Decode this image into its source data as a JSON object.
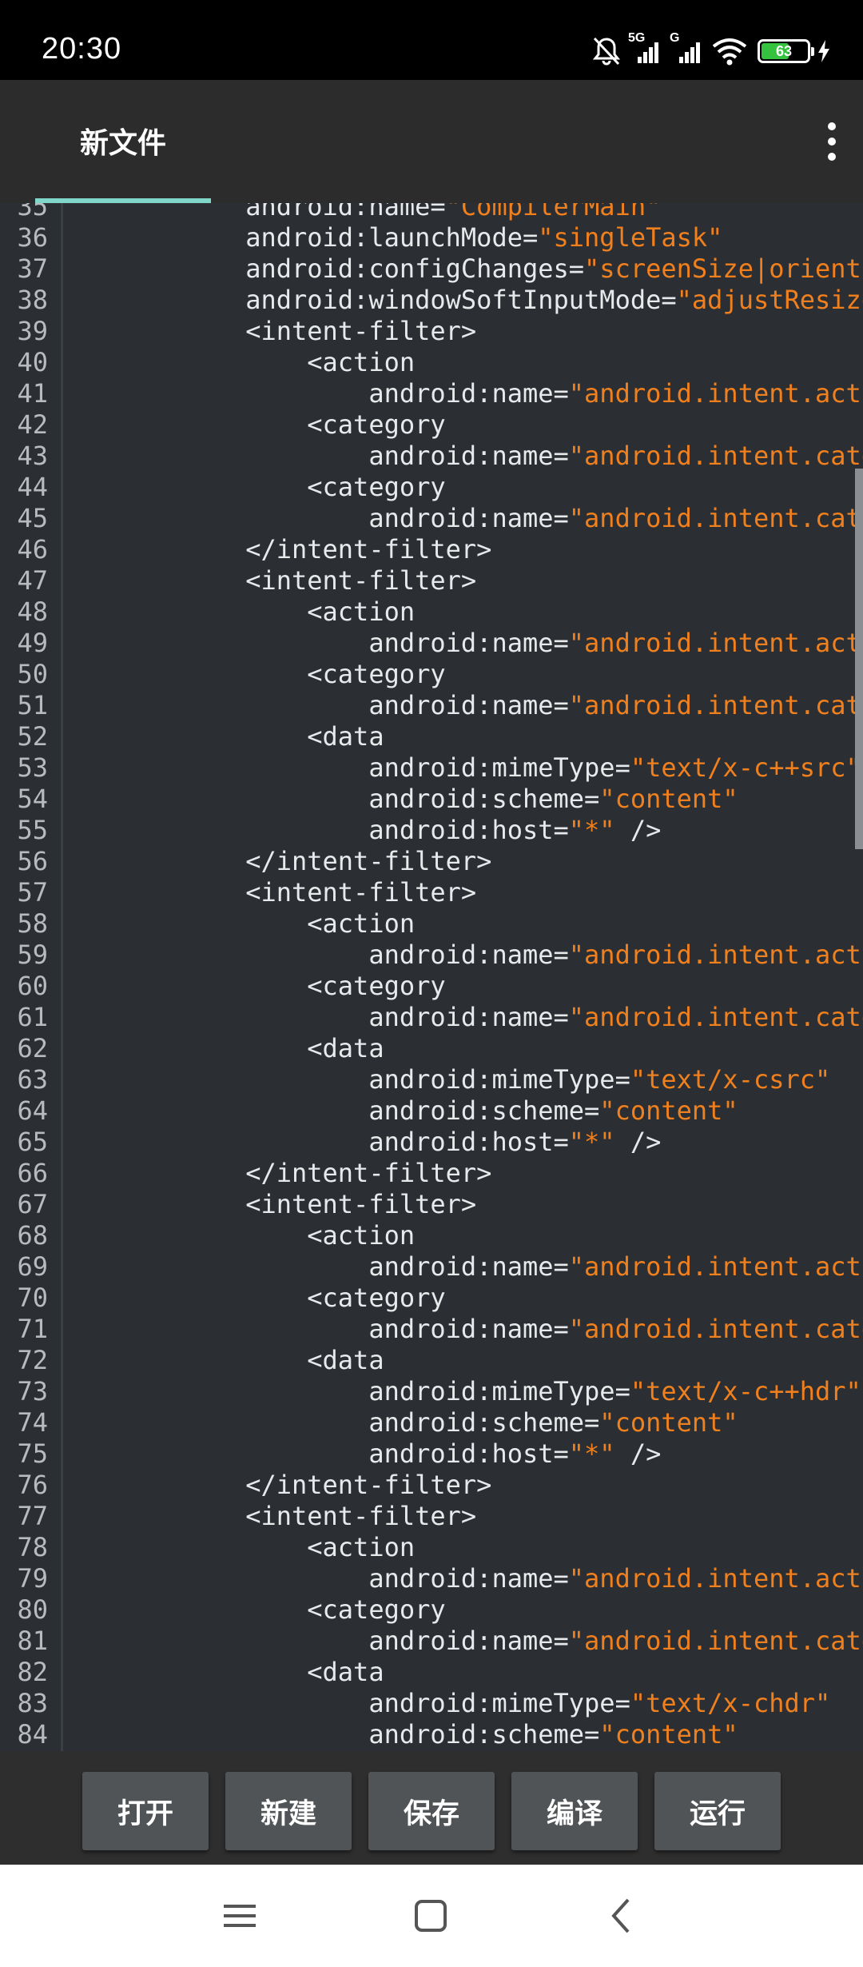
{
  "status_bar": {
    "time": "20:30",
    "network_1": "5G",
    "network_2": "G",
    "battery": "63",
    "icons": [
      "mute-icon",
      "signal-icon",
      "signal-icon",
      "wifi-icon",
      "battery-icon",
      "charging-icon"
    ]
  },
  "app_bar": {
    "tab_label": "新文件",
    "menu_icon": "overflow-menu-icon",
    "accent": "#7fd6c9"
  },
  "editor": {
    "colors": {
      "text": "#e7e9eb",
      "string": "#f0801e",
      "line_number": "#b7bbbf",
      "background": "#2b2f33"
    },
    "lines": [
      {
        "n": "35",
        "code": [
          [
            "            android:name=",
            "t"
          ],
          [
            "\"CompilerMain\"",
            "s"
          ]
        ]
      },
      {
        "n": "36",
        "code": [
          [
            "            android:launchMode=",
            "t"
          ],
          [
            "\"singleTask\"",
            "s"
          ]
        ]
      },
      {
        "n": "37",
        "code": [
          [
            "            android:configChanges=",
            "t"
          ],
          [
            "\"screenSize|orientation\"",
            "s"
          ]
        ]
      },
      {
        "n": "38",
        "code": [
          [
            "            android:windowSoftInputMode=",
            "t"
          ],
          [
            "\"adjustResize\"",
            "s"
          ]
        ]
      },
      {
        "n": "39",
        "code": [
          [
            "            <intent-filter>",
            "t"
          ]
        ]
      },
      {
        "n": "40",
        "code": [
          [
            "                <action",
            "t"
          ]
        ]
      },
      {
        "n": "41",
        "code": [
          [
            "                    android:name=",
            "t"
          ],
          [
            "\"android.intent.action.VIEW\"",
            "s"
          ]
        ]
      },
      {
        "n": "42",
        "code": [
          [
            "                <category",
            "t"
          ]
        ]
      },
      {
        "n": "43",
        "code": [
          [
            "                    android:name=",
            "t"
          ],
          [
            "\"android.intent.category.DEFAULT\"",
            "s"
          ]
        ]
      },
      {
        "n": "44",
        "code": [
          [
            "                <category",
            "t"
          ]
        ]
      },
      {
        "n": "45",
        "code": [
          [
            "                    android:name=",
            "t"
          ],
          [
            "\"android.intent.category.BROWSABLE\"",
            "s"
          ]
        ]
      },
      {
        "n": "46",
        "code": [
          [
            "            </intent-filter>",
            "t"
          ]
        ]
      },
      {
        "n": "47",
        "code": [
          [
            "            <intent-filter>",
            "t"
          ]
        ]
      },
      {
        "n": "48",
        "code": [
          [
            "                <action",
            "t"
          ]
        ]
      },
      {
        "n": "49",
        "code": [
          [
            "                    android:name=",
            "t"
          ],
          [
            "\"android.intent.action.VIEW\"",
            "s"
          ]
        ]
      },
      {
        "n": "50",
        "code": [
          [
            "                <category",
            "t"
          ]
        ]
      },
      {
        "n": "51",
        "code": [
          [
            "                    android:name=",
            "t"
          ],
          [
            "\"android.intent.category.DEFAULT\"",
            "s"
          ]
        ]
      },
      {
        "n": "52",
        "code": [
          [
            "                <data",
            "t"
          ]
        ]
      },
      {
        "n": "53",
        "code": [
          [
            "                    android:mimeType=",
            "t"
          ],
          [
            "\"text/x-c++src\"",
            "s"
          ]
        ]
      },
      {
        "n": "54",
        "code": [
          [
            "                    android:scheme=",
            "t"
          ],
          [
            "\"content\"",
            "s"
          ]
        ]
      },
      {
        "n": "55",
        "code": [
          [
            "                    android:host=",
            "t"
          ],
          [
            "\"*\"",
            "s"
          ],
          [
            " />",
            "t"
          ]
        ]
      },
      {
        "n": "56",
        "code": [
          [
            "            </intent-filter>",
            "t"
          ]
        ]
      },
      {
        "n": "57",
        "code": [
          [
            "            <intent-filter>",
            "t"
          ]
        ]
      },
      {
        "n": "58",
        "code": [
          [
            "                <action",
            "t"
          ]
        ]
      },
      {
        "n": "59",
        "code": [
          [
            "                    android:name=",
            "t"
          ],
          [
            "\"android.intent.action.VIEW\"",
            "s"
          ]
        ]
      },
      {
        "n": "60",
        "code": [
          [
            "                <category",
            "t"
          ]
        ]
      },
      {
        "n": "61",
        "code": [
          [
            "                    android:name=",
            "t"
          ],
          [
            "\"android.intent.category.DEFAULT\"",
            "s"
          ]
        ]
      },
      {
        "n": "62",
        "code": [
          [
            "                <data",
            "t"
          ]
        ]
      },
      {
        "n": "63",
        "code": [
          [
            "                    android:mimeType=",
            "t"
          ],
          [
            "\"text/x-csrc\"",
            "s"
          ]
        ]
      },
      {
        "n": "64",
        "code": [
          [
            "                    android:scheme=",
            "t"
          ],
          [
            "\"content\"",
            "s"
          ]
        ]
      },
      {
        "n": "65",
        "code": [
          [
            "                    android:host=",
            "t"
          ],
          [
            "\"*\"",
            "s"
          ],
          [
            " />",
            "t"
          ]
        ]
      },
      {
        "n": "66",
        "code": [
          [
            "            </intent-filter>",
            "t"
          ]
        ]
      },
      {
        "n": "67",
        "code": [
          [
            "            <intent-filter>",
            "t"
          ]
        ]
      },
      {
        "n": "68",
        "code": [
          [
            "                <action",
            "t"
          ]
        ]
      },
      {
        "n": "69",
        "code": [
          [
            "                    android:name=",
            "t"
          ],
          [
            "\"android.intent.action.VIEW\"",
            "s"
          ]
        ]
      },
      {
        "n": "70",
        "code": [
          [
            "                <category",
            "t"
          ]
        ]
      },
      {
        "n": "71",
        "code": [
          [
            "                    android:name=",
            "t"
          ],
          [
            "\"android.intent.category.DEFAULT\"",
            "s"
          ]
        ]
      },
      {
        "n": "72",
        "code": [
          [
            "                <data",
            "t"
          ]
        ]
      },
      {
        "n": "73",
        "code": [
          [
            "                    android:mimeType=",
            "t"
          ],
          [
            "\"text/x-c++hdr\"",
            "s"
          ]
        ]
      },
      {
        "n": "74",
        "code": [
          [
            "                    android:scheme=",
            "t"
          ],
          [
            "\"content\"",
            "s"
          ]
        ]
      },
      {
        "n": "75",
        "code": [
          [
            "                    android:host=",
            "t"
          ],
          [
            "\"*\"",
            "s"
          ],
          [
            " />",
            "t"
          ]
        ]
      },
      {
        "n": "76",
        "code": [
          [
            "            </intent-filter>",
            "t"
          ]
        ]
      },
      {
        "n": "77",
        "code": [
          [
            "            <intent-filter>",
            "t"
          ]
        ]
      },
      {
        "n": "78",
        "code": [
          [
            "                <action",
            "t"
          ]
        ]
      },
      {
        "n": "79",
        "code": [
          [
            "                    android:name=",
            "t"
          ],
          [
            "\"android.intent.action.VIEW\"",
            "s"
          ]
        ]
      },
      {
        "n": "80",
        "code": [
          [
            "                <category",
            "t"
          ]
        ]
      },
      {
        "n": "81",
        "code": [
          [
            "                    android:name=",
            "t"
          ],
          [
            "\"android.intent.category.DEFAULT\"",
            "s"
          ]
        ]
      },
      {
        "n": "82",
        "code": [
          [
            "                <data",
            "t"
          ]
        ]
      },
      {
        "n": "83",
        "code": [
          [
            "                    android:mimeType=",
            "t"
          ],
          [
            "\"text/x-chdr\"",
            "s"
          ]
        ]
      },
      {
        "n": "84",
        "code": [
          [
            "                    android:scheme=",
            "t"
          ],
          [
            "\"content\"",
            "s"
          ]
        ]
      }
    ]
  },
  "toolbar": {
    "open_label": "打开",
    "new_label": "新建",
    "save_label": "保存",
    "compile_label": "编译",
    "run_label": "运行"
  },
  "nav_bar": {
    "icons": [
      "menu-icon",
      "home-icon",
      "back-icon"
    ]
  }
}
